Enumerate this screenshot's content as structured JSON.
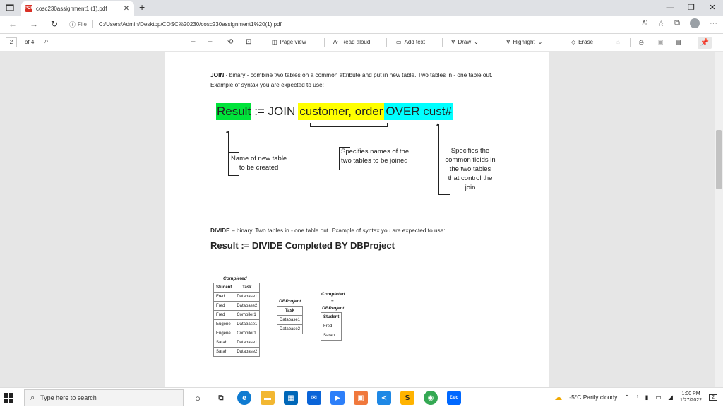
{
  "browser": {
    "tab_title": "cosc230assignment1 (1).pdf",
    "address": {
      "info_label": "File",
      "url": "C:/Users/Admin/Desktop/COSC%20230/cosc230assignment1%20(1).pdf"
    },
    "window_controls": [
      "—",
      "❐",
      "✕"
    ]
  },
  "pdf_toolbar": {
    "page_number": "2",
    "page_count": "of 4",
    "page_view": "Page view",
    "read_aloud": "Read aloud",
    "add_text": "Add text",
    "draw": "Draw",
    "highlight": "Highlight",
    "erase": "Erase"
  },
  "document": {
    "join_para": "JOIN - binary - combine two tables on a common attribute and put in new table. Two tables in - one table out. Example of syntax you are expected to use:",
    "join_label": "JOIN",
    "join_rest": " - binary - combine two tables on a common attribute and put in new table. Two tables in - one table out. Example of syntax you are expected to use:",
    "join_expr": {
      "result": "Result",
      "op": ":= JOIN",
      "tables": "customer, order",
      "over": "OVER cust#"
    },
    "ann_new_table": [
      "Name of new table",
      "to be created"
    ],
    "ann_tables": [
      "Specifies names of the",
      "two tables to be joined"
    ],
    "ann_fields": [
      "Specifies the",
      "common fields in",
      "the two tables",
      "that control the",
      "join"
    ],
    "divide_label": "DIVIDE",
    "divide_rest": " – binary. Two tables in - one table out. Example of syntax you are expected to use:",
    "divide_expr": "Result := DIVIDE Completed BY DBProject",
    "completed_table": {
      "caption": "Completed",
      "headers": [
        "Student",
        "Task"
      ],
      "rows": [
        [
          "Fred",
          "Database1"
        ],
        [
          "Fred",
          "Database2"
        ],
        [
          "Fred",
          "Compiler1"
        ],
        [
          "Eugene",
          "Database1"
        ],
        [
          "Eugene",
          "Compiler1"
        ],
        [
          "Sarah",
          "Database1"
        ],
        [
          "Sarah",
          "Database2"
        ]
      ]
    },
    "dbproject_table": {
      "caption": "DBProject",
      "headers": [
        "Task"
      ],
      "rows": [
        [
          "Database1"
        ],
        [
          "Database2"
        ]
      ]
    },
    "result_table": {
      "caption_top": "Completed",
      "arrow": "÷",
      "caption_bottom": "DBProject",
      "headers": [
        "Student"
      ],
      "rows": [
        [
          "Fred"
        ],
        [
          "Sarah"
        ]
      ]
    }
  },
  "taskbar": {
    "search_placeholder": "Type here to search",
    "weather": "-5°C  Partly cloudy",
    "time": "1:00 PM",
    "date": "1/27/2022",
    "notification_count": "2"
  },
  "colors": {
    "highlight_green": "#00e33a",
    "highlight_yellow": "#ffff00",
    "highlight_cyan": "#00ffff"
  }
}
